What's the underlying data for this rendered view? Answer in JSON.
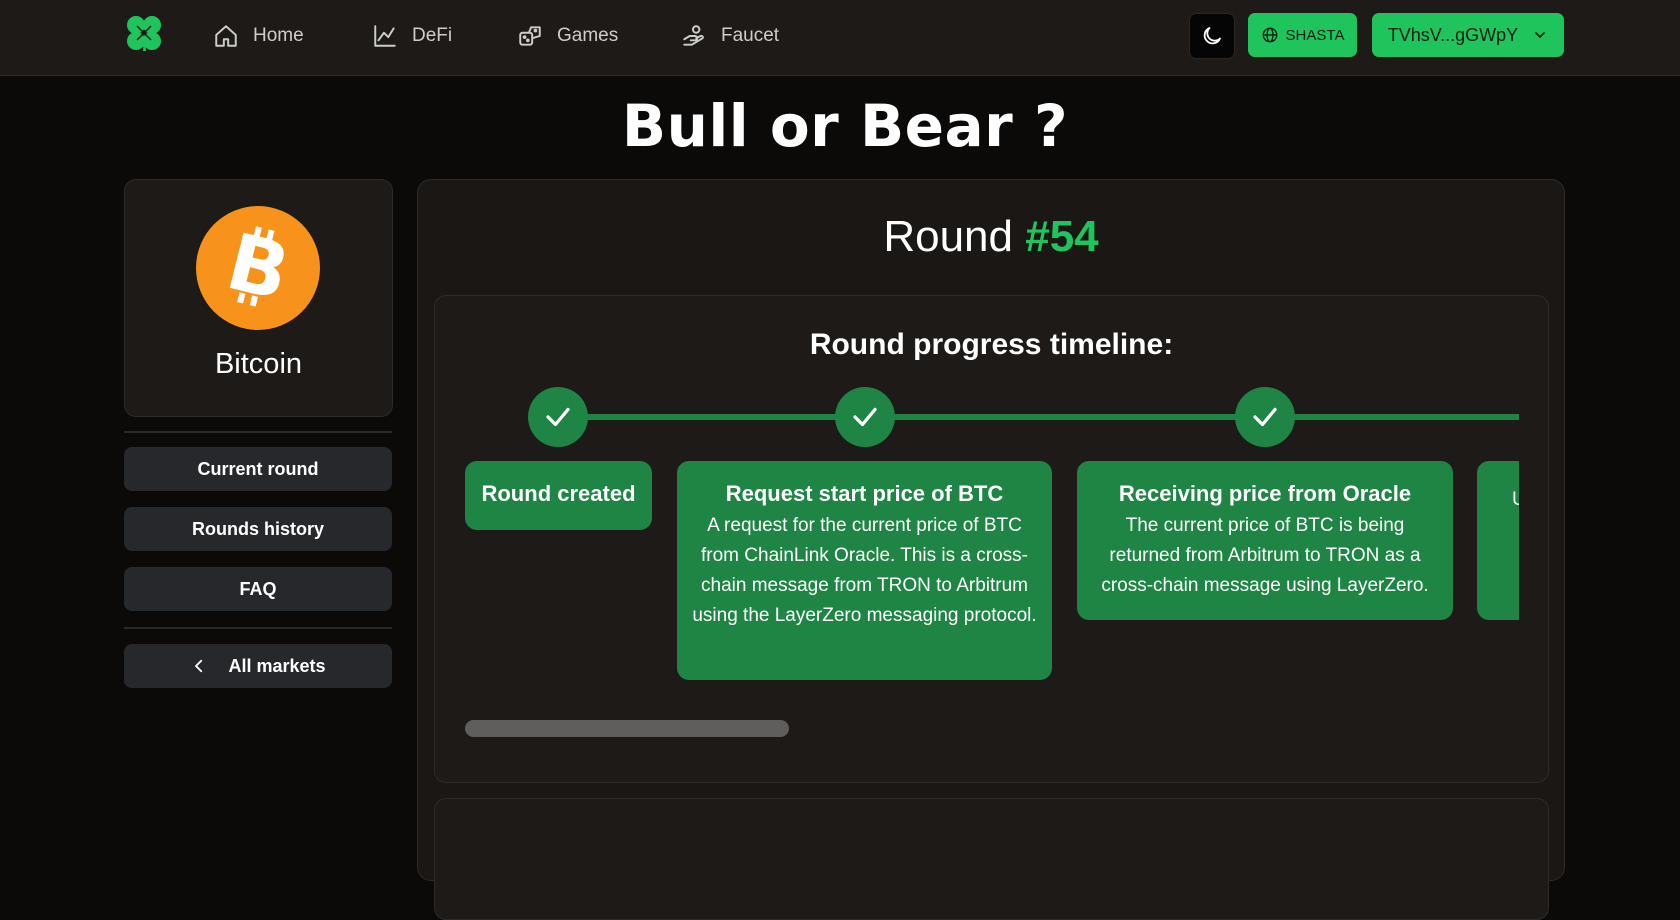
{
  "nav": {
    "items": [
      {
        "label": "Home",
        "icon": "home-icon"
      },
      {
        "label": "DeFi",
        "icon": "chart-line-icon"
      },
      {
        "label": "Games",
        "icon": "dice-icon"
      },
      {
        "label": "Faucet",
        "icon": "faucet-hand-icon"
      }
    ],
    "network_label": "SHASTA",
    "wallet_label": "TVhsV...gGWpY",
    "accent_color": "#1fc55c"
  },
  "page": {
    "title": "Bull or Bear ?"
  },
  "sidebar": {
    "coin_name": "Bitcoin",
    "buttons": {
      "current_round": "Current round",
      "rounds_history": "Rounds history",
      "faq": "FAQ",
      "all_markets": "All markets"
    }
  },
  "round": {
    "label": "Round",
    "number": "#54"
  },
  "timeline": {
    "title": "Round progress timeline:",
    "steps": [
      {
        "title": "Round created",
        "description": ""
      },
      {
        "title": "Request start price of BTC",
        "description": "A request for the current price of BTC from ChainLink Oracle. This is a cross-chain message from TRON to Arbitrum using the LayerZero messaging protocol."
      },
      {
        "title": "Receiving price from Oracle",
        "description": "The current price of BTC is being returned from Arbitrum to TRON as a cross-chain message using LayerZero."
      },
      {
        "title": "",
        "description": "U"
      }
    ]
  }
}
